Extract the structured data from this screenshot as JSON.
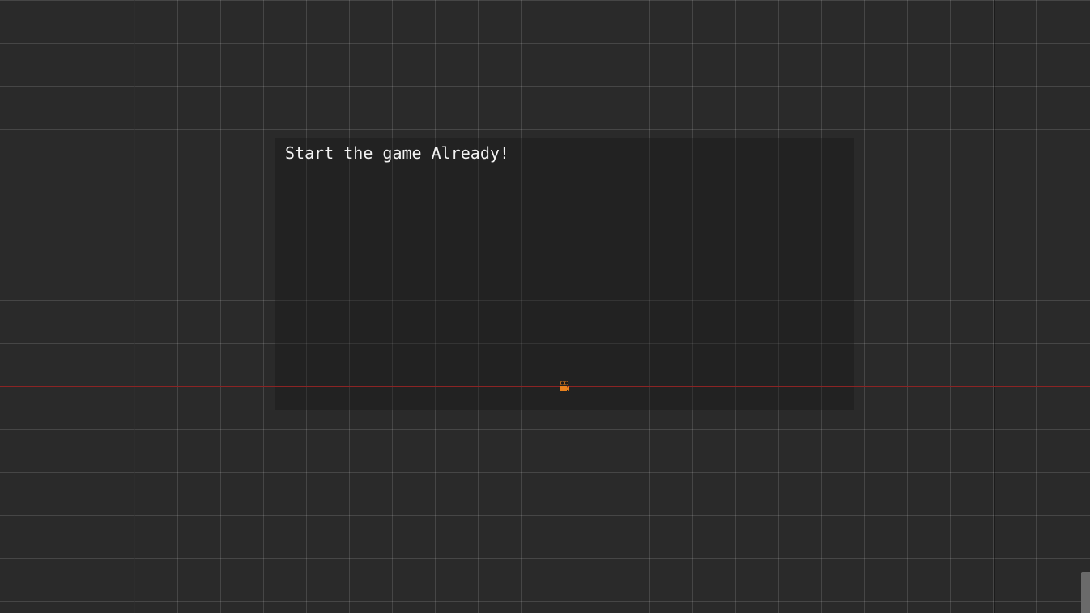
{
  "scene": {
    "label_text": "Start the game Already!",
    "colors": {
      "background": "#2a2a2a",
      "y_axis": "#2e8b2e",
      "x_axis": "#8b2424",
      "label_text": "#f2f2f2",
      "camera_icon": "#e8821e"
    }
  },
  "icons": {
    "camera": "camera-node-icon"
  }
}
